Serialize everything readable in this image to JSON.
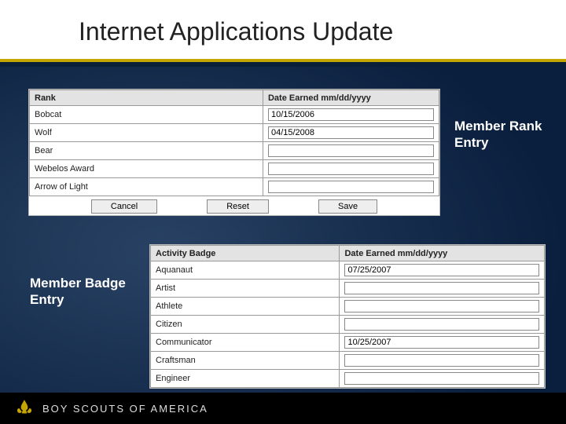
{
  "slide": {
    "title": "Internet Applications Update"
  },
  "rank_panel": {
    "header_left": "Rank",
    "header_right": "Date Earned mm/dd/yyyy",
    "rows": [
      {
        "label": "Bobcat",
        "date": "10/15/2006"
      },
      {
        "label": "Wolf",
        "date": "04/15/2008"
      },
      {
        "label": "Bear",
        "date": ""
      },
      {
        "label": "Webelos Award",
        "date": ""
      },
      {
        "label": "Arrow of Light",
        "date": ""
      }
    ],
    "buttons": {
      "cancel": "Cancel",
      "reset": "Reset",
      "save": "Save"
    }
  },
  "badge_panel": {
    "header_left": "Activity Badge",
    "header_right": "Date Earned mm/dd/yyyy",
    "rows": [
      {
        "label": "Aquanaut",
        "date": "07/25/2007"
      },
      {
        "label": "Artist",
        "date": ""
      },
      {
        "label": "Athlete",
        "date": ""
      },
      {
        "label": "Citizen",
        "date": ""
      },
      {
        "label": "Communicator",
        "date": "10/25/2007"
      },
      {
        "label": "Craftsman",
        "date": ""
      },
      {
        "label": "Engineer",
        "date": ""
      }
    ]
  },
  "annotations": {
    "rank": "Member Rank Entry",
    "badge": "Member Badge Entry"
  },
  "footer": {
    "org": "BOY SCOUTS OF AMERICA"
  }
}
